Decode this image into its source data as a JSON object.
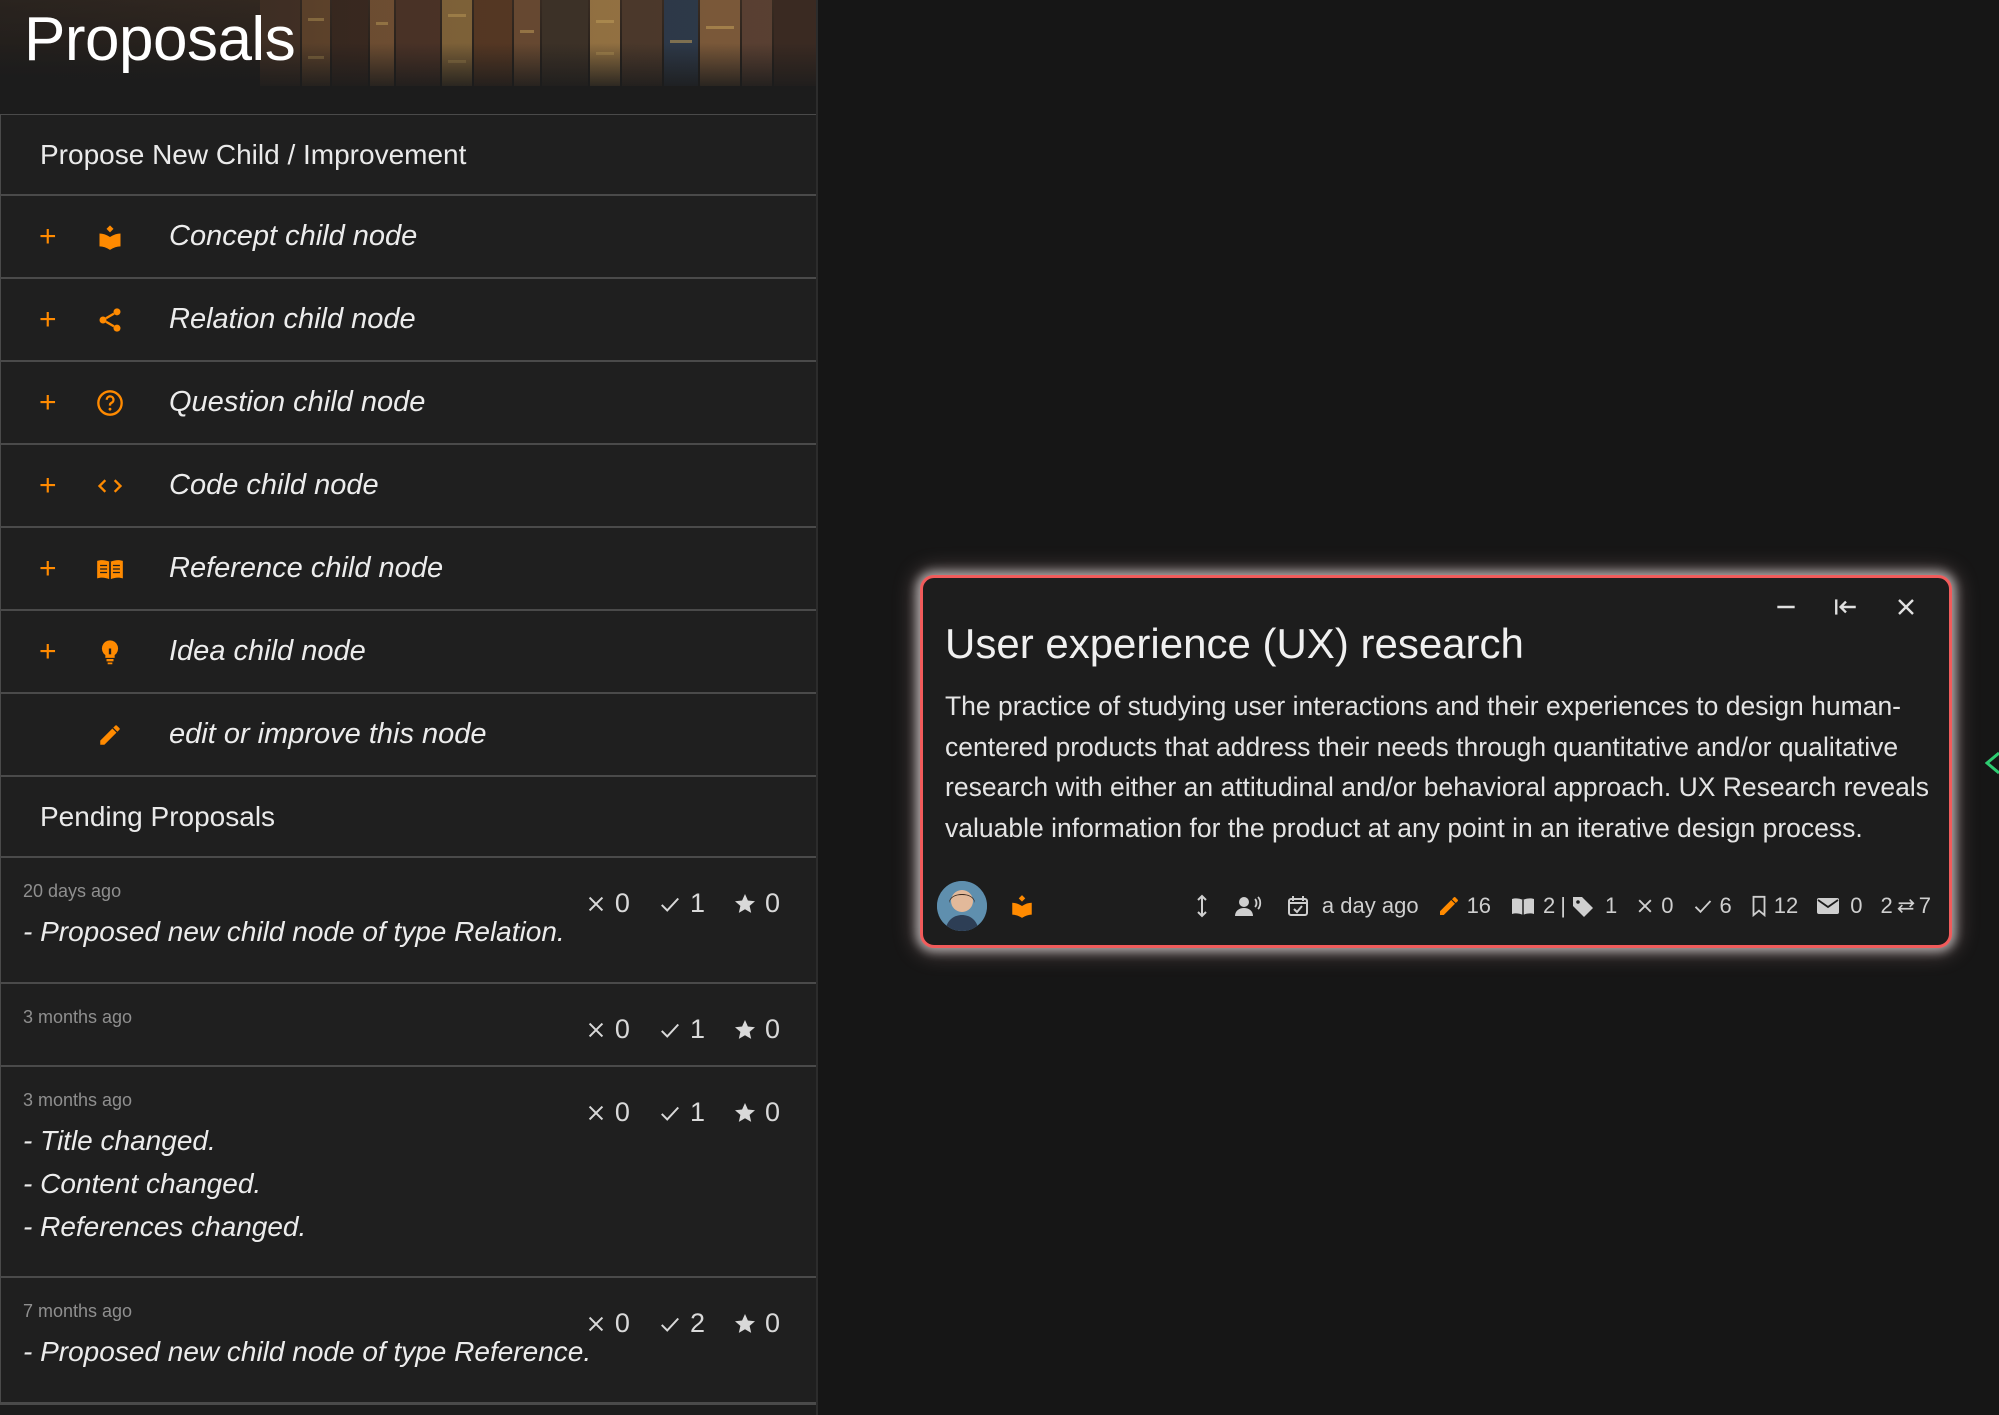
{
  "sidebar": {
    "title": "Proposals",
    "propose_header": "Propose New Child / Improvement",
    "options": [
      {
        "label": "Concept child node",
        "icon": "concept-icon",
        "has_plus": true
      },
      {
        "label": "Relation child node",
        "icon": "share-icon",
        "has_plus": true
      },
      {
        "label": "Question child node",
        "icon": "question-icon",
        "has_plus": true
      },
      {
        "label": "Code child node",
        "icon": "code-icon",
        "has_plus": true
      },
      {
        "label": "Reference child node",
        "icon": "book-icon",
        "has_plus": true
      },
      {
        "label": "Idea child node",
        "icon": "lightbulb-icon",
        "has_plus": true
      },
      {
        "label": "edit or improve this node",
        "icon": "pencil-icon",
        "has_plus": false
      }
    ],
    "pending_header": "Pending Proposals",
    "proposals": [
      {
        "time": "20 days ago",
        "downvotes": "0",
        "upvotes": "1",
        "stars": "0",
        "lines": [
          "- Proposed new child node of type Relation."
        ]
      },
      {
        "time": "3 months ago",
        "downvotes": "0",
        "upvotes": "1",
        "stars": "0",
        "lines": []
      },
      {
        "time": "3 months ago",
        "downvotes": "0",
        "upvotes": "1",
        "stars": "0",
        "lines": [
          "- Title changed.",
          "- Content changed.",
          "- References changed."
        ]
      },
      {
        "time": "7 months ago",
        "downvotes": "0",
        "upvotes": "2",
        "stars": "0",
        "lines": [
          "- Proposed new child node of type Reference."
        ]
      }
    ]
  },
  "node": {
    "title": "User experience (UX) research",
    "content": "The practice of studying user interactions and their experiences to design human-centered products that address their needs through quantitative and/or qualitative research with either an attitudinal and/or behavioral approach. UX Research reveals valuable information for the product at any point in an iterative design process.",
    "updated": "a day ago",
    "edits": "16",
    "references": "2",
    "tags": "1",
    "downvotes": "0",
    "upvotes": "6",
    "bookmarks": "12",
    "messages": "0",
    "parents": "2",
    "children": "7",
    "border_color": "#f15b5b"
  },
  "colors": {
    "accent": "#ff8a00",
    "edge": "#2ecc71"
  }
}
